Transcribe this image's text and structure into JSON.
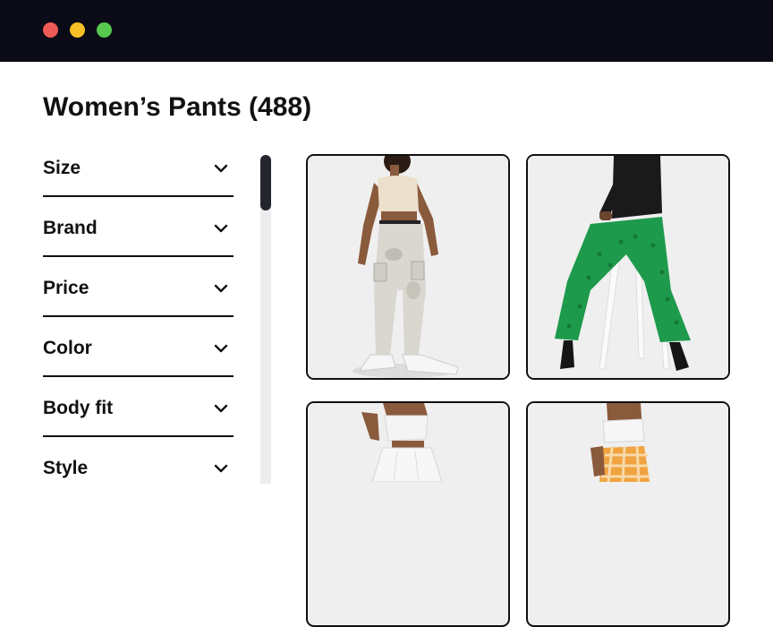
{
  "window": {
    "controls": [
      "close-button",
      "minimize-button",
      "maximize-button"
    ]
  },
  "page": {
    "title": "Women’s Pants (488)"
  },
  "filters": [
    {
      "label": "Size",
      "icon": "chevron-down-icon"
    },
    {
      "label": "Brand",
      "icon": "chevron-down-icon"
    },
    {
      "label": "Price",
      "icon": "chevron-down-icon"
    },
    {
      "label": "Color",
      "icon": "chevron-down-icon"
    },
    {
      "label": "Body fit",
      "icon": "chevron-down-icon"
    },
    {
      "label": "Style",
      "icon": "chevron-down-icon"
    }
  ],
  "products": [
    {
      "image": "model wearing light camo cargo pants and beige tank top",
      "pants_color": "#d9d7d0"
    },
    {
      "image": "seated model wearing green eyelet flared pants and black blazer",
      "pants_color": "#1e9a4c"
    },
    {
      "image": "model wearing white pleated pants and white bandeau top",
      "pants_color": "#f3f3f3"
    },
    {
      "image": "model wearing orange gingham pants and white cami",
      "pants_color": "#f0a340"
    }
  ],
  "colors": {
    "titlebar": "#0a0b16",
    "close": "#ee5b57",
    "minimize": "#f6c026",
    "maximize": "#58c850",
    "scroll_thumb": "#23252f"
  }
}
